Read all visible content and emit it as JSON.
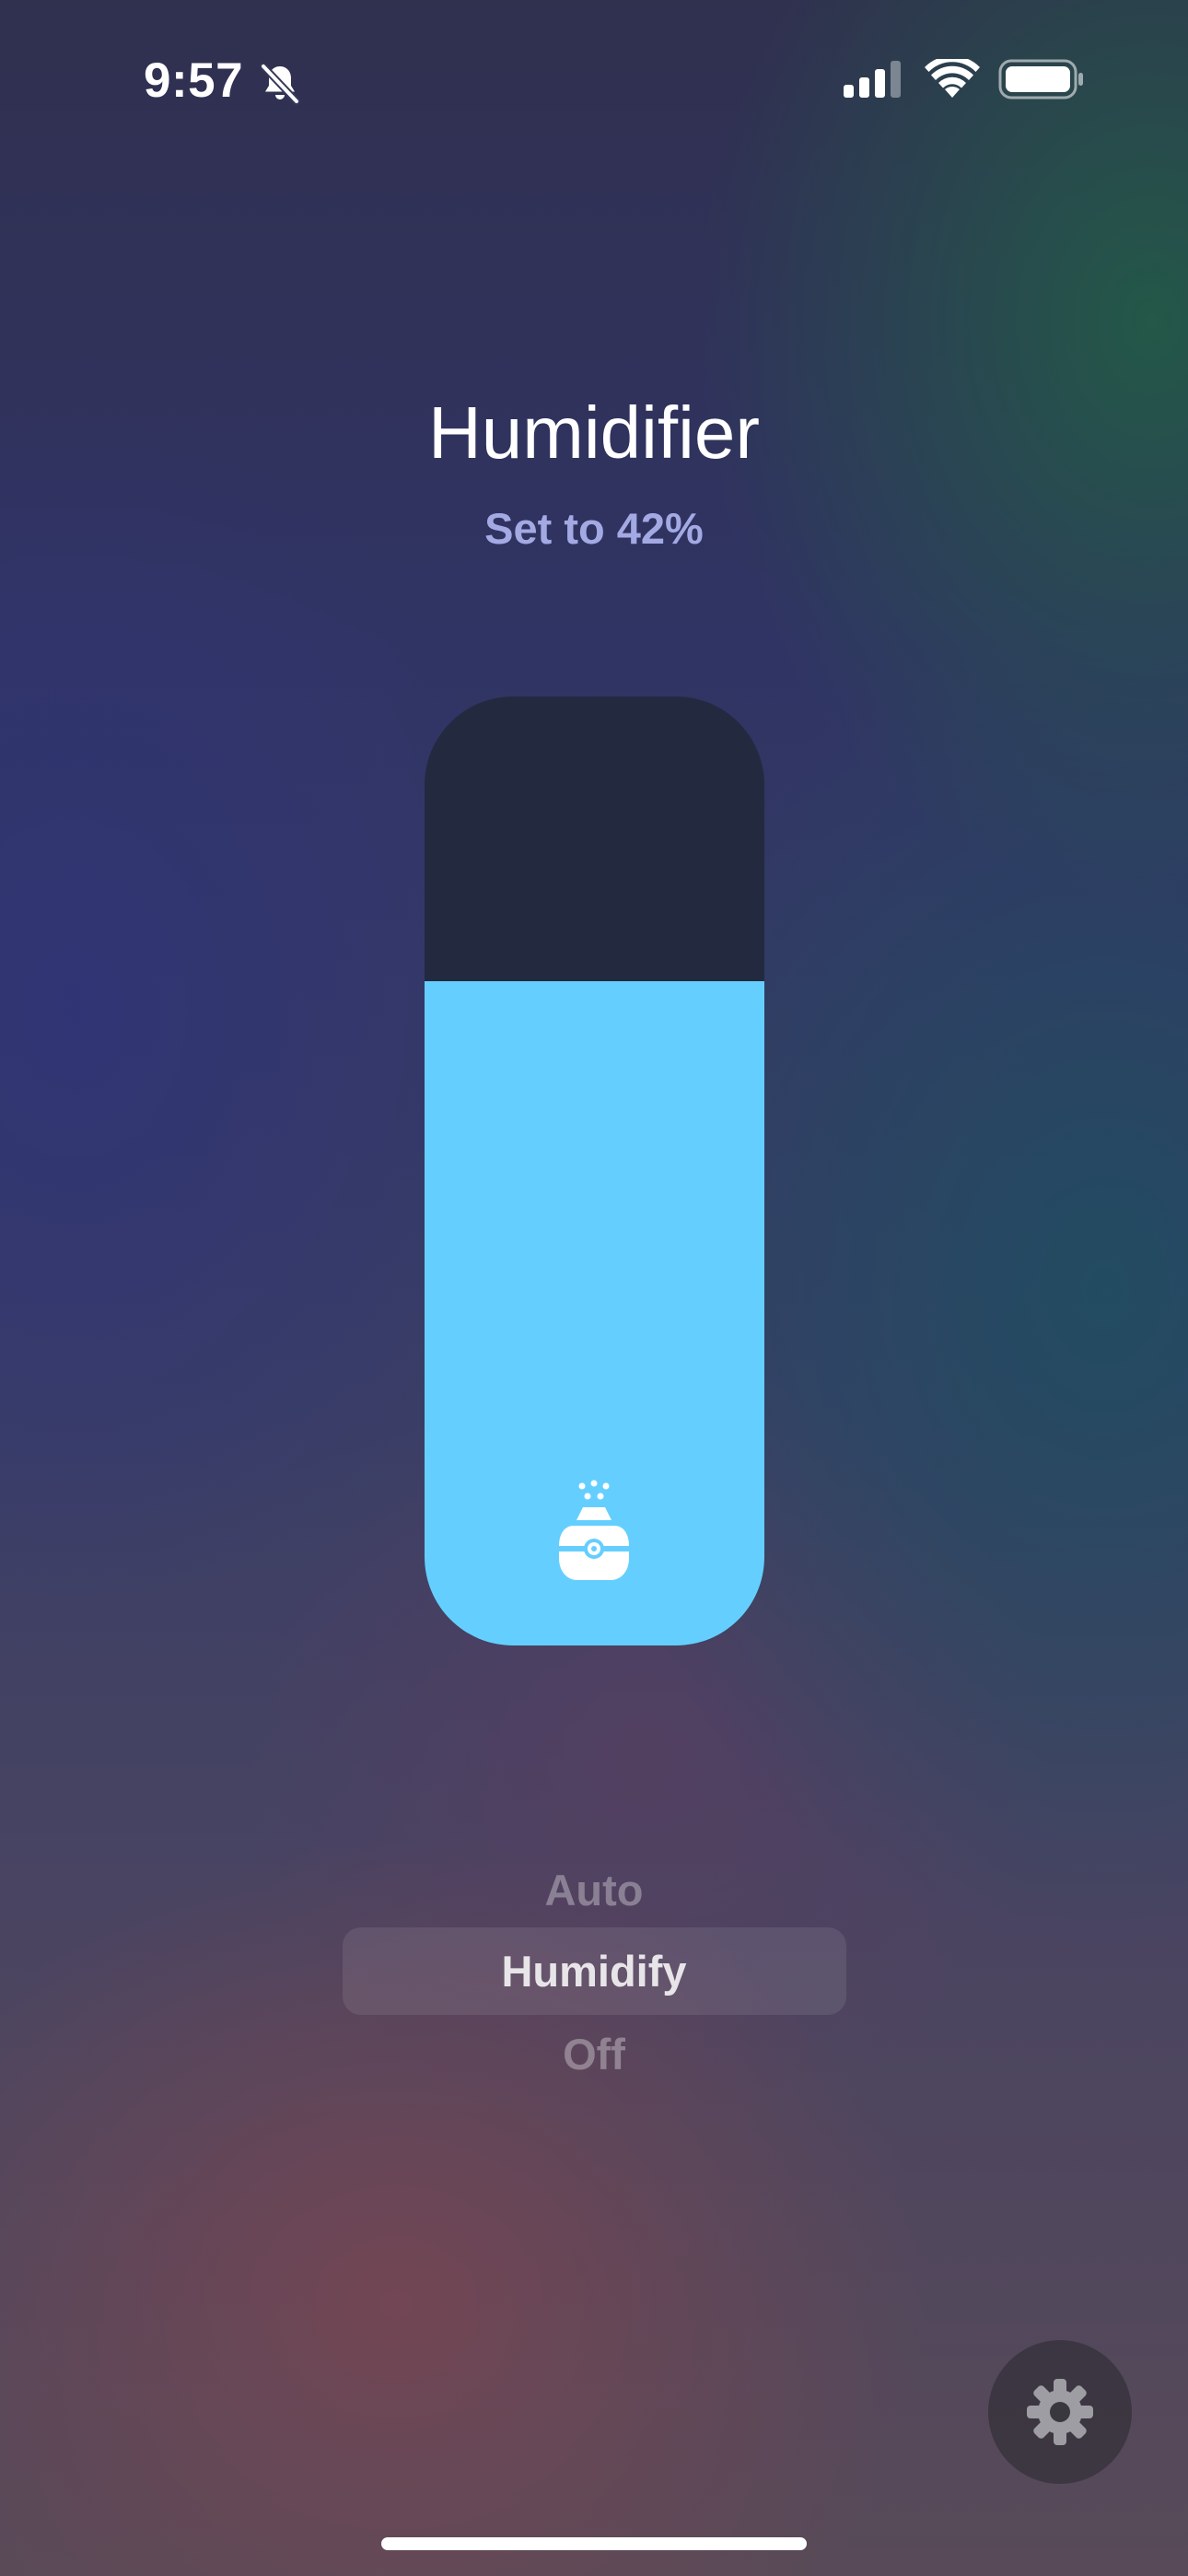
{
  "status_bar": {
    "time": "9:57",
    "icons": [
      "bell-slash-icon",
      "cellular-signal-icon",
      "wifi-icon",
      "battery-icon"
    ]
  },
  "device": {
    "title": "Humidifier",
    "subtitle": "Set to 42%",
    "icon": "humidifier-icon"
  },
  "slider": {
    "level_percent": 70,
    "fill_color": "#64cffe",
    "track_color": "#232a40"
  },
  "modes": {
    "options": [
      "Auto",
      "Humidify",
      "Off"
    ],
    "selected": "Humidify"
  },
  "settings": {
    "icon": "gear-icon"
  },
  "colors": {
    "subtitle": "#a3a9e3"
  }
}
